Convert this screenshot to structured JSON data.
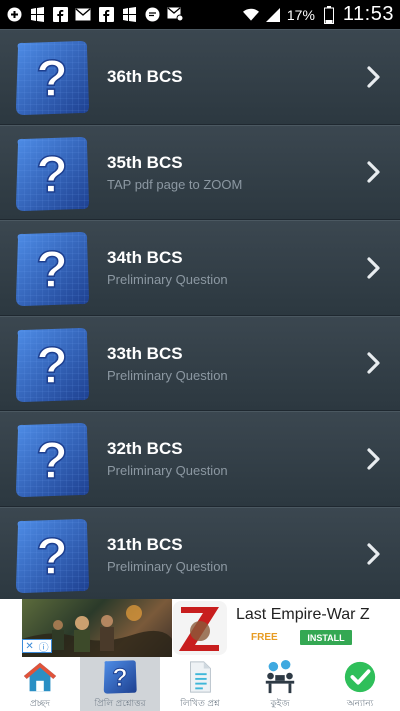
{
  "status_bar": {
    "battery_percent": "17%",
    "time": "11:53",
    "icons": [
      "plus-circle-icon",
      "windows-icon",
      "facebook-icon",
      "mail-icon",
      "facebook-icon",
      "windows-icon",
      "chat-icon",
      "mail-icon"
    ]
  },
  "list": {
    "items": [
      {
        "title": "36th BCS",
        "subtitle": ""
      },
      {
        "title": "35th BCS",
        "subtitle": "TAP pdf page to ZOOM"
      },
      {
        "title": "34th BCS",
        "subtitle": "Preliminary Question"
      },
      {
        "title": "33th BCS",
        "subtitle": "Preliminary Question"
      },
      {
        "title": "32th BCS",
        "subtitle": "Preliminary Question"
      },
      {
        "title": "31th BCS",
        "subtitle": "Preliminary Question"
      }
    ]
  },
  "ad": {
    "title": "Last Empire-War Z",
    "price": "FREE",
    "install_label": "INSTALL"
  },
  "bottom_nav": {
    "items": [
      {
        "label": "প্রচ্ছদ",
        "icon": "home-icon"
      },
      {
        "label": "প্রিলি প্রশ্নোত্তর",
        "icon": "question-icon"
      },
      {
        "label": "লিখিত প্রশ্ন",
        "icon": "document-icon"
      },
      {
        "label": "কুইজ",
        "icon": "quiz-icon"
      },
      {
        "label": "অন্যান্য",
        "icon": "check-icon"
      }
    ]
  },
  "colors": {
    "row_bg": "#2e3840",
    "accent_blue": "#2a5fb8",
    "install_green": "#34a853",
    "free_orange": "#e79b22"
  }
}
